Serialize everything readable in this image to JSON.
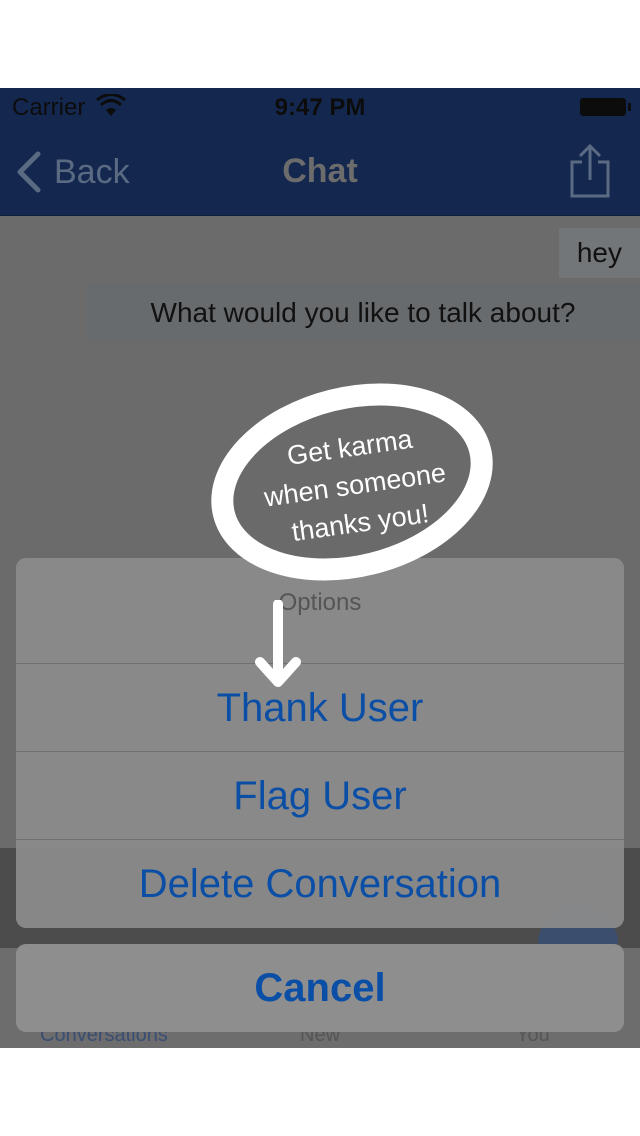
{
  "status_bar": {
    "carrier": "Carrier",
    "time": "9:47 PM"
  },
  "nav": {
    "back_label": "Back",
    "title": "Chat"
  },
  "messages": [
    {
      "text": "hey"
    },
    {
      "text": "What would you like to talk about?"
    }
  ],
  "tab_bar": {
    "tab1": "Conversations",
    "tab2": "New",
    "tab3": "You"
  },
  "hint": {
    "line1": "Get karma",
    "line2": "when someone",
    "line3": "thanks you!"
  },
  "action_sheet": {
    "title": "Options",
    "actions": [
      "Thank User",
      "Flag User",
      "Delete Conversation"
    ],
    "cancel": "Cancel"
  },
  "colors": {
    "nav_bar": "#14284f",
    "action_text": "#0a4ea6",
    "overlay": "#6a6a6a"
  }
}
